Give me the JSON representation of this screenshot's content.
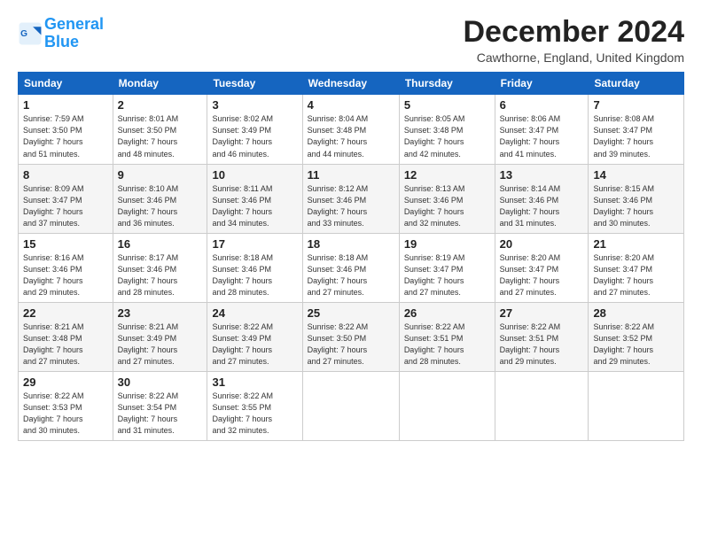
{
  "logo": {
    "line1": "General",
    "line2": "Blue"
  },
  "title": "December 2024",
  "subtitle": "Cawthorne, England, United Kingdom",
  "days_header": [
    "Sunday",
    "Monday",
    "Tuesday",
    "Wednesday",
    "Thursday",
    "Friday",
    "Saturday"
  ],
  "weeks": [
    [
      {
        "day": "1",
        "info": "Sunrise: 7:59 AM\nSunset: 3:50 PM\nDaylight: 7 hours\nand 51 minutes."
      },
      {
        "day": "2",
        "info": "Sunrise: 8:01 AM\nSunset: 3:50 PM\nDaylight: 7 hours\nand 48 minutes."
      },
      {
        "day": "3",
        "info": "Sunrise: 8:02 AM\nSunset: 3:49 PM\nDaylight: 7 hours\nand 46 minutes."
      },
      {
        "day": "4",
        "info": "Sunrise: 8:04 AM\nSunset: 3:48 PM\nDaylight: 7 hours\nand 44 minutes."
      },
      {
        "day": "5",
        "info": "Sunrise: 8:05 AM\nSunset: 3:48 PM\nDaylight: 7 hours\nand 42 minutes."
      },
      {
        "day": "6",
        "info": "Sunrise: 8:06 AM\nSunset: 3:47 PM\nDaylight: 7 hours\nand 41 minutes."
      },
      {
        "day": "7",
        "info": "Sunrise: 8:08 AM\nSunset: 3:47 PM\nDaylight: 7 hours\nand 39 minutes."
      }
    ],
    [
      {
        "day": "8",
        "info": "Sunrise: 8:09 AM\nSunset: 3:47 PM\nDaylight: 7 hours\nand 37 minutes."
      },
      {
        "day": "9",
        "info": "Sunrise: 8:10 AM\nSunset: 3:46 PM\nDaylight: 7 hours\nand 36 minutes."
      },
      {
        "day": "10",
        "info": "Sunrise: 8:11 AM\nSunset: 3:46 PM\nDaylight: 7 hours\nand 34 minutes."
      },
      {
        "day": "11",
        "info": "Sunrise: 8:12 AM\nSunset: 3:46 PM\nDaylight: 7 hours\nand 33 minutes."
      },
      {
        "day": "12",
        "info": "Sunrise: 8:13 AM\nSunset: 3:46 PM\nDaylight: 7 hours\nand 32 minutes."
      },
      {
        "day": "13",
        "info": "Sunrise: 8:14 AM\nSunset: 3:46 PM\nDaylight: 7 hours\nand 31 minutes."
      },
      {
        "day": "14",
        "info": "Sunrise: 8:15 AM\nSunset: 3:46 PM\nDaylight: 7 hours\nand 30 minutes."
      }
    ],
    [
      {
        "day": "15",
        "info": "Sunrise: 8:16 AM\nSunset: 3:46 PM\nDaylight: 7 hours\nand 29 minutes."
      },
      {
        "day": "16",
        "info": "Sunrise: 8:17 AM\nSunset: 3:46 PM\nDaylight: 7 hours\nand 28 minutes."
      },
      {
        "day": "17",
        "info": "Sunrise: 8:18 AM\nSunset: 3:46 PM\nDaylight: 7 hours\nand 28 minutes."
      },
      {
        "day": "18",
        "info": "Sunrise: 8:18 AM\nSunset: 3:46 PM\nDaylight: 7 hours\nand 27 minutes."
      },
      {
        "day": "19",
        "info": "Sunrise: 8:19 AM\nSunset: 3:47 PM\nDaylight: 7 hours\nand 27 minutes."
      },
      {
        "day": "20",
        "info": "Sunrise: 8:20 AM\nSunset: 3:47 PM\nDaylight: 7 hours\nand 27 minutes."
      },
      {
        "day": "21",
        "info": "Sunrise: 8:20 AM\nSunset: 3:47 PM\nDaylight: 7 hours\nand 27 minutes."
      }
    ],
    [
      {
        "day": "22",
        "info": "Sunrise: 8:21 AM\nSunset: 3:48 PM\nDaylight: 7 hours\nand 27 minutes."
      },
      {
        "day": "23",
        "info": "Sunrise: 8:21 AM\nSunset: 3:49 PM\nDaylight: 7 hours\nand 27 minutes."
      },
      {
        "day": "24",
        "info": "Sunrise: 8:22 AM\nSunset: 3:49 PM\nDaylight: 7 hours\nand 27 minutes."
      },
      {
        "day": "25",
        "info": "Sunrise: 8:22 AM\nSunset: 3:50 PM\nDaylight: 7 hours\nand 27 minutes."
      },
      {
        "day": "26",
        "info": "Sunrise: 8:22 AM\nSunset: 3:51 PM\nDaylight: 7 hours\nand 28 minutes."
      },
      {
        "day": "27",
        "info": "Sunrise: 8:22 AM\nSunset: 3:51 PM\nDaylight: 7 hours\nand 29 minutes."
      },
      {
        "day": "28",
        "info": "Sunrise: 8:22 AM\nSunset: 3:52 PM\nDaylight: 7 hours\nand 29 minutes."
      }
    ],
    [
      {
        "day": "29",
        "info": "Sunrise: 8:22 AM\nSunset: 3:53 PM\nDaylight: 7 hours\nand 30 minutes."
      },
      {
        "day": "30",
        "info": "Sunrise: 8:22 AM\nSunset: 3:54 PM\nDaylight: 7 hours\nand 31 minutes."
      },
      {
        "day": "31",
        "info": "Sunrise: 8:22 AM\nSunset: 3:55 PM\nDaylight: 7 hours\nand 32 minutes."
      },
      null,
      null,
      null,
      null
    ]
  ]
}
